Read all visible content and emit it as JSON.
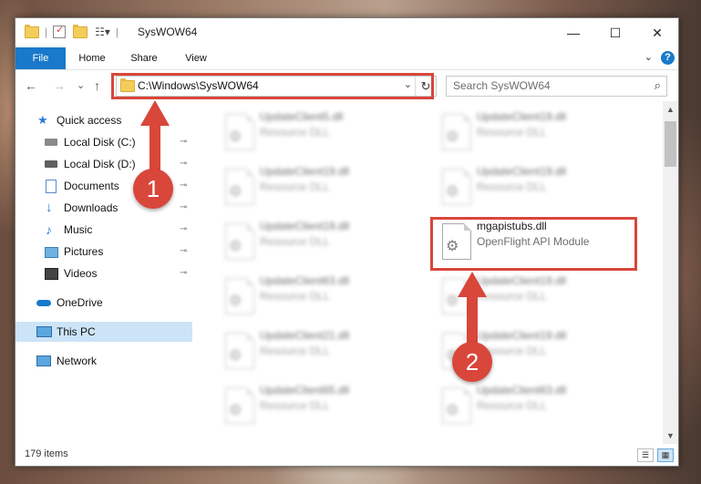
{
  "window": {
    "title": "SysWOW64",
    "controls": {
      "minimize": "—",
      "maximize": "☐",
      "close": "✕"
    }
  },
  "ribbon": {
    "tabs": [
      "File",
      "Home",
      "Share",
      "View"
    ],
    "help": "?",
    "expand": "⌄"
  },
  "nav": {
    "back": "←",
    "forward": "→",
    "recent": "⌄",
    "up": "↑"
  },
  "address": {
    "path": "C:\\Windows\\SysWOW64",
    "dropdown": "⌄",
    "refresh": "↻"
  },
  "search": {
    "placeholder": "Search SysWOW64",
    "icon": "search-icon"
  },
  "sidebar": {
    "items": [
      {
        "label": "Quick access",
        "icon": "star-icon",
        "pinned": false
      },
      {
        "label": "Local Disk (C:)",
        "icon": "drive-icon",
        "pinned": true
      },
      {
        "label": "Local Disk (D:)",
        "icon": "drive-icon",
        "pinned": true
      },
      {
        "label": "Documents",
        "icon": "document-icon",
        "pinned": true
      },
      {
        "label": "Downloads",
        "icon": "download-icon",
        "pinned": true
      },
      {
        "label": "Music",
        "icon": "music-icon",
        "pinned": true
      },
      {
        "label": "Pictures",
        "icon": "picture-icon",
        "pinned": true
      },
      {
        "label": "Videos",
        "icon": "video-icon",
        "pinned": true
      },
      {
        "label": "OneDrive",
        "icon": "cloud-icon",
        "pinned": false
      },
      {
        "label": "This PC",
        "icon": "computer-icon",
        "pinned": false,
        "selected": true
      },
      {
        "label": "Network",
        "icon": "network-icon",
        "pinned": false
      }
    ],
    "pin_glyph": "📌"
  },
  "files": [
    {
      "name": "UpdateClient5.dll",
      "type": "Resource DLL",
      "blurred": true
    },
    {
      "name": "UpdateClient19.dll",
      "type": "Resource DLL",
      "blurred": true
    },
    {
      "name": "UpdateClient19.dll",
      "type": "Resource DLL",
      "blurred": true
    },
    {
      "name": "UpdateClient19.dll",
      "type": "Resource DLL",
      "blurred": true
    },
    {
      "name": "UpdateClient19.dll",
      "type": "Resource DLL",
      "blurred": true
    },
    {
      "name": "mgapistubs.dll",
      "type": "OpenFlight API Module",
      "blurred": false
    },
    {
      "name": "UpdateClient63.dll",
      "type": "Resource DLL",
      "blurred": true
    },
    {
      "name": "UpdateClient19.dll",
      "type": "Resource DLL",
      "blurred": true
    },
    {
      "name": "UpdateClient21.dll",
      "type": "Resource DLL",
      "blurred": true
    },
    {
      "name": "UpdateClient19.dll",
      "type": "Resource DLL",
      "blurred": true
    },
    {
      "name": "UpdateClient65.dll",
      "type": "Resource DLL",
      "blurred": true
    },
    {
      "name": "UpdateClient63.dll",
      "type": "Resource DLL",
      "blurred": true
    }
  ],
  "status": {
    "item_count": "179 items",
    "view_details": "☰",
    "view_tiles": "▦"
  },
  "annotations": {
    "badge1": "1",
    "badge2": "2",
    "color": "#d9463a"
  },
  "colors": {
    "accent": "#1979ca",
    "selection": "#cce4f7"
  }
}
